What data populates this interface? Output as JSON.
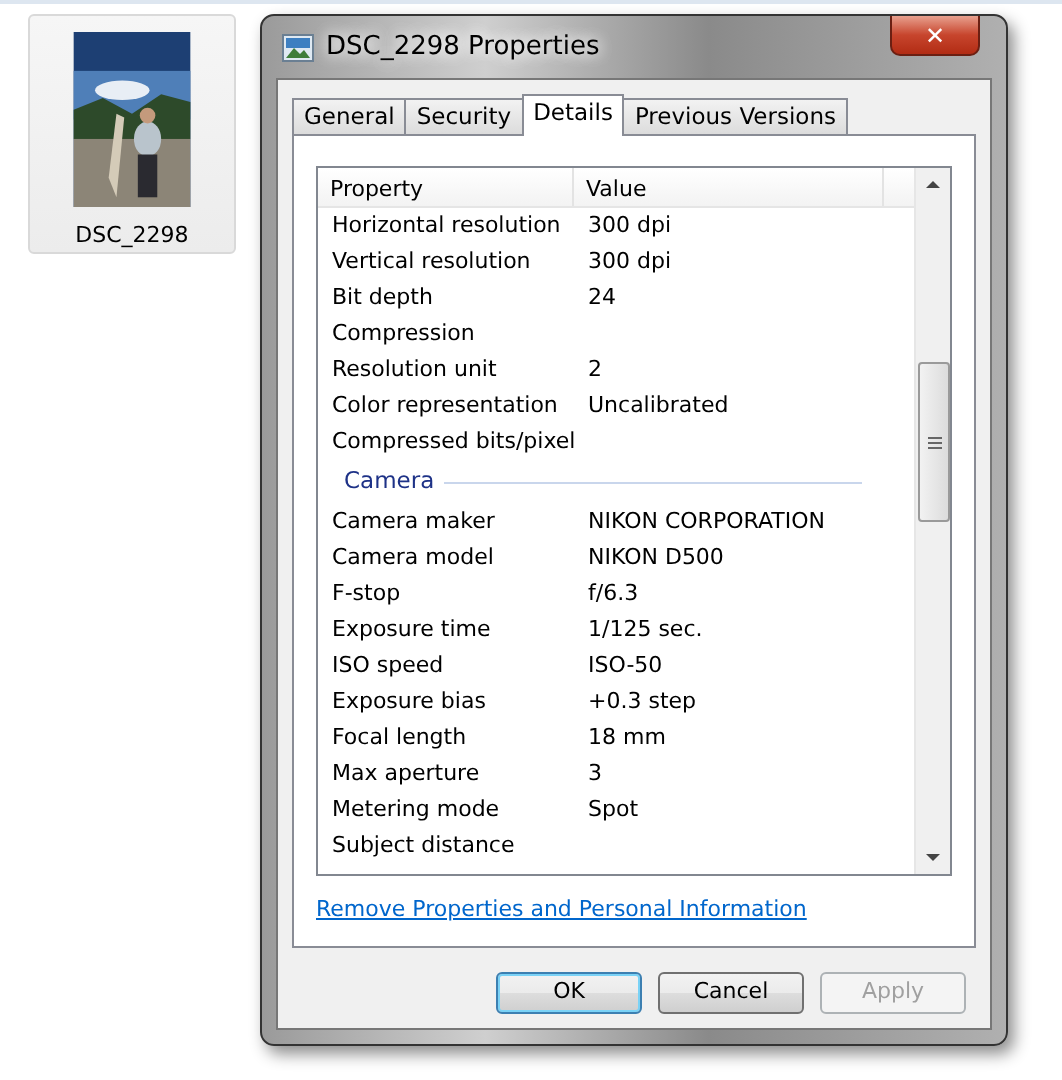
{
  "desktop_icon": {
    "label": "DSC_2298",
    "selected": true
  },
  "window": {
    "title": "DSC_2298 Properties",
    "close": "✕"
  },
  "tabs": [
    {
      "label": "General",
      "selected": false
    },
    {
      "label": "Security",
      "selected": false
    },
    {
      "label": "Details",
      "selected": true
    },
    {
      "label": "Previous Versions",
      "selected": false
    }
  ],
  "table": {
    "columns": [
      "Property",
      "Value"
    ],
    "rows": [
      {
        "kind": "row",
        "property": "Horizontal resolution",
        "value": "300 dpi"
      },
      {
        "kind": "row",
        "property": "Vertical resolution",
        "value": "300 dpi"
      },
      {
        "kind": "row",
        "property": "Bit depth",
        "value": "24"
      },
      {
        "kind": "row",
        "property": "Compression",
        "value": ""
      },
      {
        "kind": "row",
        "property": "Resolution unit",
        "value": "2"
      },
      {
        "kind": "row",
        "property": "Color representation",
        "value": "Uncalibrated"
      },
      {
        "kind": "row",
        "property": "Compressed bits/pixel",
        "value": ""
      },
      {
        "kind": "group",
        "property": "Camera"
      },
      {
        "kind": "row",
        "property": "Camera maker",
        "value": "NIKON CORPORATION"
      },
      {
        "kind": "row",
        "property": "Camera model",
        "value": "NIKON D500"
      },
      {
        "kind": "row",
        "property": "F-stop",
        "value": "f/6.3"
      },
      {
        "kind": "row",
        "property": "Exposure time",
        "value": "1/125 sec."
      },
      {
        "kind": "row",
        "property": "ISO speed",
        "value": "ISO-50"
      },
      {
        "kind": "row",
        "property": "Exposure bias",
        "value": "+0.3 step"
      },
      {
        "kind": "row",
        "property": "Focal length",
        "value": "18 mm"
      },
      {
        "kind": "row",
        "property": "Max aperture",
        "value": "3"
      },
      {
        "kind": "row",
        "property": "Metering mode",
        "value": "Spot"
      },
      {
        "kind": "row",
        "property": "Subject distance",
        "value": ""
      }
    ]
  },
  "link": "Remove Properties and Personal Information",
  "buttons": [
    {
      "label": "OK",
      "default": true,
      "disabled": false
    },
    {
      "label": "Cancel",
      "default": false,
      "disabled": false
    },
    {
      "label": "Apply",
      "default": false,
      "disabled": true
    }
  ]
}
